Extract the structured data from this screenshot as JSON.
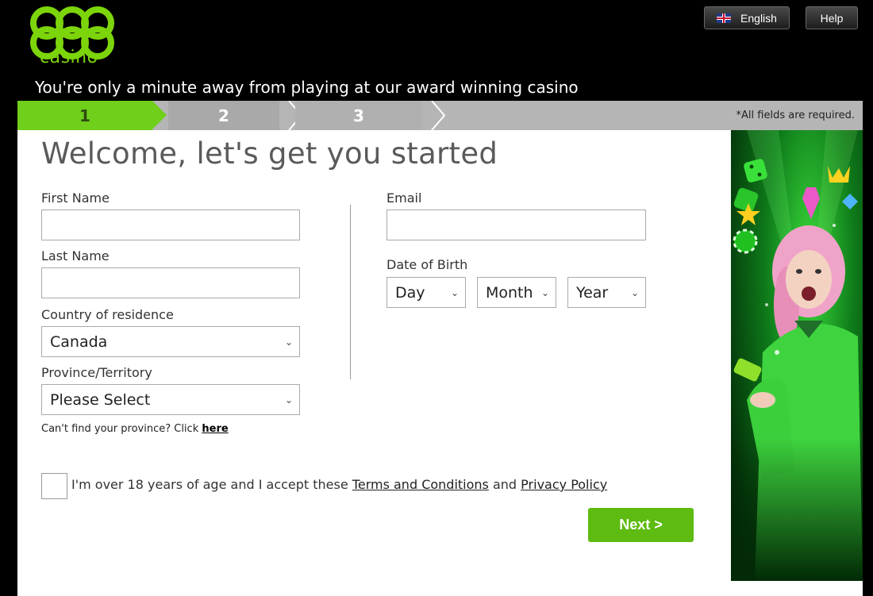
{
  "brand": {
    "logo_digits": "888",
    "logo_word": "casino",
    "accent": "#7cd50a"
  },
  "header": {
    "tagline": "You're only a minute away from playing at our award winning casino",
    "language_label": "English",
    "help_label": "Help"
  },
  "steps": {
    "items": [
      {
        "label": "1",
        "active": true
      },
      {
        "label": "2",
        "active": false
      },
      {
        "label": "3",
        "active": false
      }
    ],
    "required_note": "*All fields are required."
  },
  "form": {
    "heading": "Welcome, let's get you started",
    "first_name": {
      "label": "First Name",
      "value": ""
    },
    "last_name": {
      "label": "Last Name",
      "value": ""
    },
    "country": {
      "label": "Country of residence",
      "selected": "Canada"
    },
    "province": {
      "label": "Province/Territory",
      "selected": "Please Select"
    },
    "province_hint": {
      "text": "Can't find your province? Click",
      "link": "here"
    },
    "email": {
      "label": "Email",
      "value": ""
    },
    "dob": {
      "label": "Date of Birth",
      "day": "Day",
      "month": "Month",
      "year": "Year"
    },
    "consent": {
      "text_before": "I'm over 18 years of age and I accept these",
      "terms_link": "Terms and Conditions",
      "and": "and",
      "privacy_link": "Privacy Policy",
      "checked": false
    },
    "next_label": "Next >"
  },
  "colors": {
    "step_active": "#6fcf1a",
    "next_button": "#5dbb12"
  }
}
